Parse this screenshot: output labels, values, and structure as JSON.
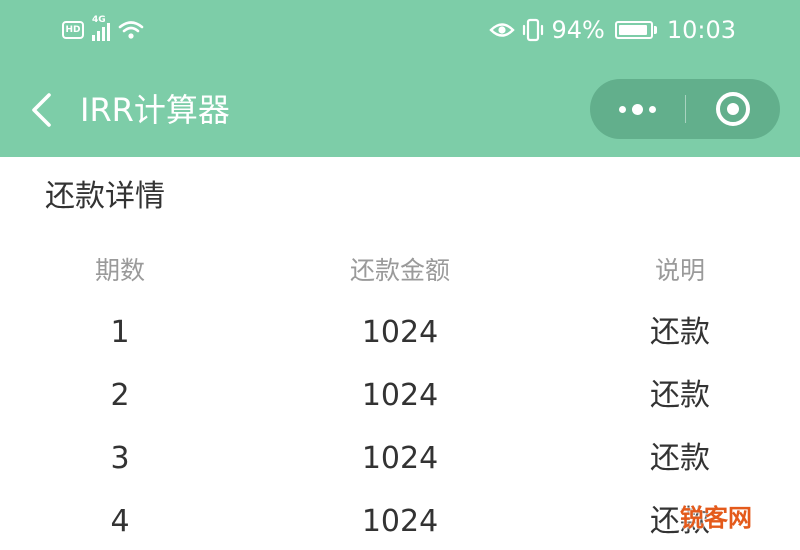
{
  "status_bar": {
    "hd_label": "HD",
    "network_type": "4G",
    "battery_percent": "94%",
    "battery_level": 0.94,
    "time": "10:03",
    "icons": [
      "hd-icon",
      "signal-icon",
      "wifi-icon",
      "eye-icon",
      "vibrate-icon",
      "battery-icon"
    ]
  },
  "nav": {
    "back_icon": "chevron-left-icon",
    "title": "IRR计算器",
    "capsule": {
      "menu_icon": "more-dots-icon",
      "close_icon": "target-circle-icon"
    }
  },
  "section": {
    "title": "还款详情"
  },
  "table": {
    "headers": [
      "期数",
      "还款金额",
      "说明"
    ],
    "rows": [
      [
        "1",
        "1024",
        "还款"
      ],
      [
        "2",
        "1024",
        "还款"
      ],
      [
        "3",
        "1024",
        "还款"
      ],
      [
        "4",
        "1024",
        "还款"
      ]
    ]
  },
  "watermark": {
    "text": "锐客网"
  },
  "colors": {
    "header_bg": "#7dcda8",
    "capsule_bg": "#62af8c",
    "text_primary": "#333333",
    "text_secondary": "#9a9a9a",
    "watermark": "#e45a1b"
  }
}
